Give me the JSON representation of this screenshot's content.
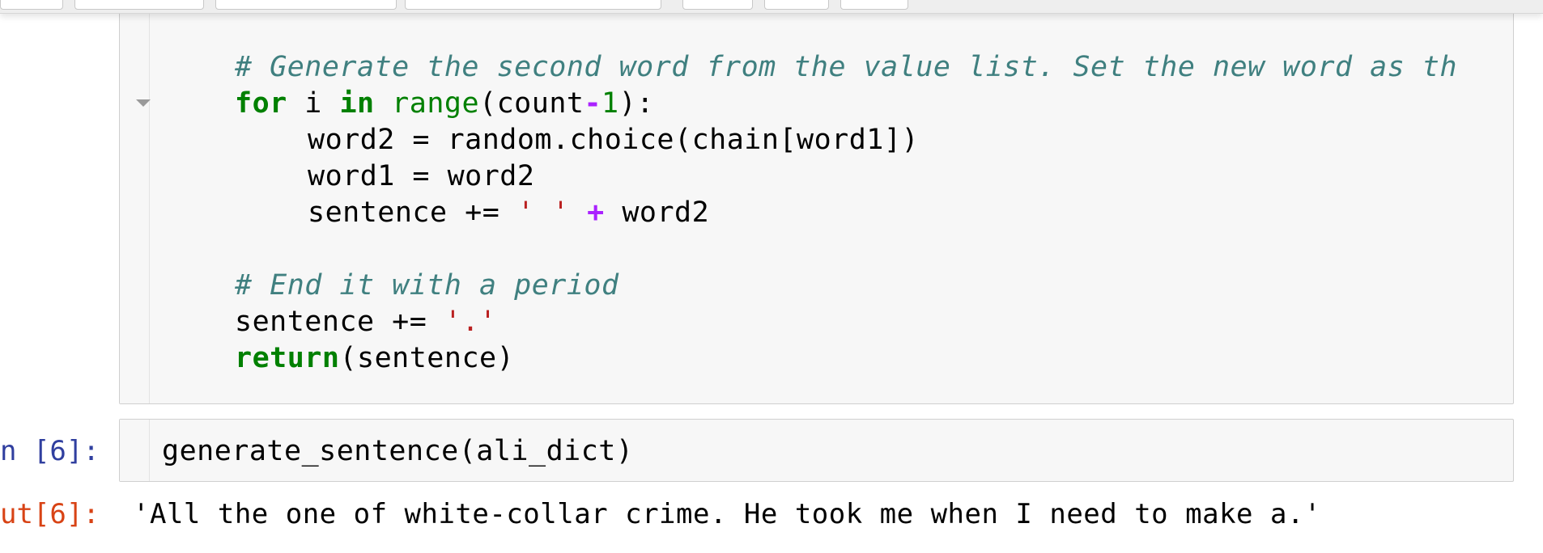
{
  "cells": {
    "code_cell": {
      "lines": [
        {
          "text": "# Generate the second word from the value list. Set the new word as th"
        },
        {
          "kw1": "for",
          "t1": " i ",
          "kw2": "in",
          "t2": " ",
          "bi": "range",
          "t3": "(count",
          "op": "-",
          "num": "1",
          "t4": "):"
        },
        {
          "text": "word2 = random.choice(chain[word1])"
        },
        {
          "text": "word1 = word2"
        },
        {
          "t1": "sentence += ",
          "str": "' '",
          "t2": " ",
          "op": "+",
          "t3": " word2"
        },
        {
          "text": ""
        },
        {
          "text": "# End it with a period"
        },
        {
          "t1": "sentence += ",
          "str": "'.'"
        },
        {
          "kw": "return",
          "t1": "(sentence)"
        }
      ]
    },
    "in_cell": {
      "prompt": "n [6]:",
      "code": "generate_sentence(ali_dict)"
    },
    "out_cell": {
      "prompt": "ut[6]:",
      "output": "'All the one of white-collar crime. He took me when I need to make a.'"
    }
  },
  "colors": {
    "keyword": "#008000",
    "comment": "#408080",
    "operator": "#aa22ff",
    "string": "#ba2121",
    "prompt_in": "#303f9f",
    "prompt_out": "#d84315"
  }
}
